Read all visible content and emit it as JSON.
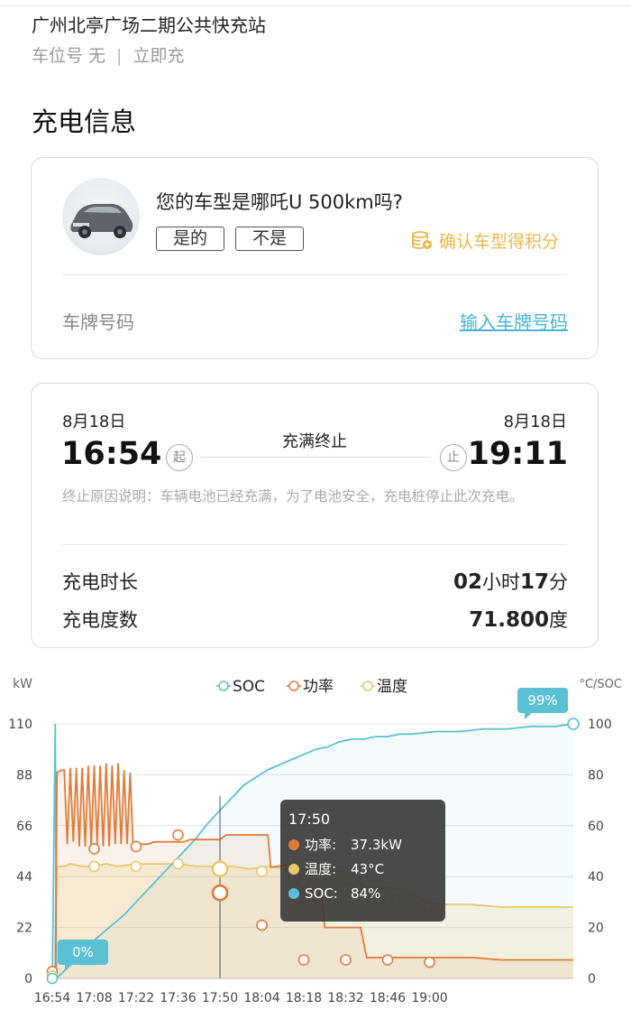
{
  "header": {
    "station_name": "广州北亭广场二期公共快充站",
    "spot_label": "车位号 无",
    "separator": "|",
    "mode": "立即充"
  },
  "section_title": "充电信息",
  "vehicle_card": {
    "question": "您的车型是哪吒U 500km吗?",
    "yes_label": "是的",
    "no_label": "不是",
    "confirm_label": "确认车型得积分",
    "plate_label": "车牌号码",
    "plate_link": "输入车牌号码",
    "accent_color": "#e8b84a",
    "link_color": "#49b4d6"
  },
  "session": {
    "start_date": "8月18日",
    "end_date": "8月18日",
    "start_time": "16:54",
    "end_time": "19:11",
    "start_tag": "起",
    "end_tag": "止",
    "status": "充满终止",
    "reason": "终止原因说明：车辆电池已经充满，为了电池安全，充电桩停止此次充电。",
    "duration_label": "充电时长",
    "duration_hours": "02",
    "hours_unit": "小时",
    "duration_minutes": "17",
    "minutes_unit": "分",
    "energy_label": "充电度数",
    "energy_value": "71.800",
    "energy_unit": "度"
  },
  "chart_data": {
    "type": "line",
    "ylabel_left": "kW",
    "ylabel_right": "°C/SOC",
    "ylim_left": [
      0,
      110
    ],
    "ylim_right": [
      0,
      100
    ],
    "yticks_left": [
      "0",
      "22",
      "44",
      "66",
      "88",
      "110"
    ],
    "yticks_right": [
      "0",
      "20",
      "40",
      "60",
      "80",
      "100"
    ],
    "xticks": [
      "16:54",
      "17:08",
      "17:22",
      "17:36",
      "17:50",
      "18:04",
      "18:18",
      "18:32",
      "18:46",
      "19:00"
    ],
    "legend": [
      "SOC",
      "功率",
      "温度"
    ],
    "series": [
      {
        "name": "SOC",
        "axis": "right",
        "color": "#5bc0d3",
        "points": [
          [
            0,
            0
          ],
          [
            1,
            100
          ],
          [
            1.4,
            0
          ],
          [
            4,
            3
          ],
          [
            8,
            8
          ],
          [
            12,
            13
          ],
          [
            16,
            17
          ],
          [
            20,
            21
          ],
          [
            24,
            25
          ],
          [
            28,
            30
          ],
          [
            32,
            35
          ],
          [
            36,
            40
          ],
          [
            40,
            45
          ],
          [
            44,
            50
          ],
          [
            48,
            55
          ],
          [
            52,
            61
          ],
          [
            56,
            66
          ],
          [
            60,
            71
          ],
          [
            64,
            76
          ],
          [
            68,
            79
          ],
          [
            72,
            82
          ],
          [
            76,
            84
          ],
          [
            80,
            86
          ],
          [
            84,
            88
          ],
          [
            88,
            90
          ],
          [
            92,
            91
          ],
          [
            96,
            93
          ],
          [
            100,
            94
          ],
          [
            104,
            94
          ],
          [
            108,
            95
          ],
          [
            112,
            95
          ],
          [
            116,
            96
          ],
          [
            120,
            96
          ],
          [
            128,
            97
          ],
          [
            136,
            97
          ],
          [
            144,
            98
          ],
          [
            152,
            98
          ],
          [
            160,
            99
          ],
          [
            168,
            99
          ],
          [
            174,
            100
          ]
        ]
      },
      {
        "name": "功率",
        "axis": "left",
        "color": "#e07b39",
        "points": [
          [
            0,
            3
          ],
          [
            1,
            3
          ],
          [
            1.6,
            89
          ],
          [
            3,
            90
          ],
          [
            4,
            90
          ],
          [
            5,
            58
          ],
          [
            6,
            91
          ],
          [
            7,
            59
          ],
          [
            8,
            91
          ],
          [
            9,
            57
          ],
          [
            10,
            91
          ],
          [
            11,
            57
          ],
          [
            12,
            92
          ],
          [
            13,
            57
          ],
          [
            14,
            92
          ],
          [
            15,
            58
          ],
          [
            16,
            92
          ],
          [
            17,
            57
          ],
          [
            18,
            93
          ],
          [
            19,
            57
          ],
          [
            20,
            92
          ],
          [
            21,
            58
          ],
          [
            22,
            93
          ],
          [
            23,
            58
          ],
          [
            24,
            90
          ],
          [
            25,
            58
          ],
          [
            26,
            89
          ],
          [
            27,
            57
          ],
          [
            28,
            58
          ],
          [
            32,
            58
          ],
          [
            34,
            59
          ],
          [
            44,
            59
          ],
          [
            46,
            60
          ],
          [
            56,
            60
          ],
          [
            58,
            62
          ],
          [
            70,
            62
          ],
          [
            72,
            62
          ],
          [
            73,
            48
          ],
          [
            78,
            49
          ],
          [
            82,
            49
          ],
          [
            84,
            37
          ],
          [
            88,
            37
          ],
          [
            90,
            37
          ],
          [
            91,
            22
          ],
          [
            98,
            22
          ],
          [
            100,
            22
          ],
          [
            103,
            22
          ],
          [
            105,
            9
          ],
          [
            110,
            9
          ],
          [
            140,
            9
          ],
          [
            150,
            8
          ],
          [
            156,
            8
          ],
          [
            166,
            8
          ],
          [
            170,
            8
          ],
          [
            174,
            8
          ]
        ],
        "markers": [
          [
            0,
            3
          ],
          [
            14,
            56
          ],
          [
            28,
            57
          ],
          [
            42,
            62
          ],
          [
            56,
            37
          ],
          [
            70,
            23
          ],
          [
            84,
            8
          ],
          [
            98,
            8
          ],
          [
            112,
            8
          ],
          [
            126,
            7
          ]
        ]
      },
      {
        "name": "温度",
        "axis": "right",
        "color": "#e8c86a",
        "points": [
          [
            0,
            1
          ],
          [
            1,
            1
          ],
          [
            1.6,
            44
          ],
          [
            4,
            44
          ],
          [
            6,
            45
          ],
          [
            10,
            44
          ],
          [
            14,
            44
          ],
          [
            18,
            45
          ],
          [
            22,
            44
          ],
          [
            28,
            45
          ],
          [
            36,
            45
          ],
          [
            42,
            45
          ],
          [
            48,
            44
          ],
          [
            55,
            44
          ],
          [
            56,
            44
          ],
          [
            60,
            44
          ],
          [
            66,
            43
          ],
          [
            72,
            44
          ],
          [
            78,
            43
          ],
          [
            84,
            43
          ],
          [
            90,
            43
          ],
          [
            96,
            42
          ],
          [
            100,
            42
          ],
          [
            104,
            36
          ],
          [
            110,
            36
          ],
          [
            116,
            35
          ],
          [
            120,
            33
          ],
          [
            126,
            30
          ],
          [
            130,
            29
          ],
          [
            140,
            29
          ],
          [
            150,
            28
          ],
          [
            160,
            28
          ],
          [
            174,
            28
          ]
        ],
        "markers": [
          [
            0,
            1
          ],
          [
            14,
            44
          ],
          [
            28,
            44
          ],
          [
            42,
            45
          ],
          [
            56,
            43
          ],
          [
            70,
            42
          ],
          [
            84,
            38
          ],
          [
            98,
            35
          ],
          [
            112,
            30
          ],
          [
            126,
            28
          ]
        ]
      }
    ],
    "tooltip": {
      "time": "17:50",
      "power_label": "功率:",
      "power_value": "37.3kW",
      "temp_label": "温度:",
      "temp_value": "43°C",
      "soc_label": "SOC:",
      "soc_value": "84%"
    },
    "badges": {
      "start_soc": "0%",
      "end_soc": "99%"
    }
  }
}
